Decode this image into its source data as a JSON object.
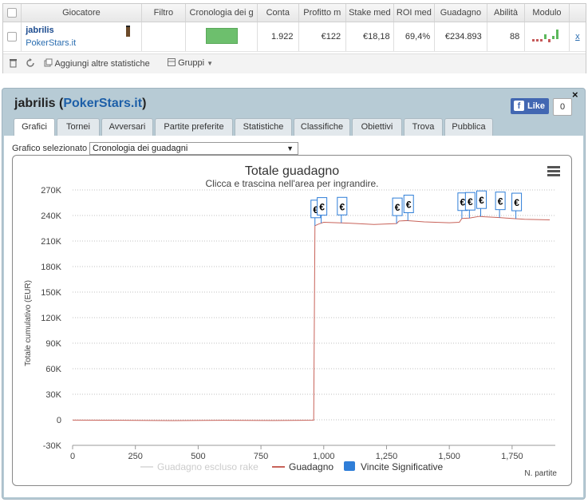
{
  "table": {
    "headers": [
      "Giocatore",
      "Filtro",
      "Cronologia dei g",
      "Conta",
      "Profitto m",
      "Stake med",
      "ROI med",
      "Guadagno",
      "Abilità",
      "Modulo"
    ],
    "row": {
      "player": "jabrilis",
      "site": "PokerStars.it",
      "count": "1.922",
      "avg_profit": "€122",
      "avg_stake": "€18,18",
      "avg_roi": "69,4%",
      "winnings": "€234.893",
      "ability": "88",
      "remove": "x"
    }
  },
  "toolbar": {
    "add_stats": "Aggiungi altre statistiche",
    "groups": "Gruppi"
  },
  "profile": {
    "name": "jabrilis",
    "site": "PokerStars.it",
    "like_label": "Like",
    "like_count": "0",
    "close": "×"
  },
  "tabs": [
    "Grafici",
    "Tornei",
    "Avversari",
    "Partite preferite",
    "Statistiche",
    "Classifiche",
    "Obiettivi",
    "Trova",
    "Pubblica"
  ],
  "active_tab": "Grafici",
  "chart_selector": {
    "label": "Grafico selezionato",
    "value": "Cronologia dei guadagni"
  },
  "chart_data": {
    "type": "line",
    "title": "Totale guadagno",
    "subtitle": "Clicca e trascina nell'area per ingrandire.",
    "ylabel": "Totale cumulativo (EUR)",
    "xlabel": "N. partite",
    "xlim": [
      0,
      1922
    ],
    "ylim": [
      -30000,
      270000
    ],
    "xticks": [
      0,
      250,
      500,
      750,
      1000,
      1250,
      1500,
      1750
    ],
    "xtick_labels": [
      "0",
      "250",
      "500",
      "750",
      "1,000",
      "1,250",
      "1,500",
      "1,750"
    ],
    "yticks": [
      -30000,
      0,
      30000,
      60000,
      90000,
      120000,
      150000,
      180000,
      210000,
      240000,
      270000
    ],
    "ytick_labels": [
      "-30K",
      "0",
      "30K",
      "60K",
      "90K",
      "120K",
      "150K",
      "180K",
      "210K",
      "240K",
      "270K"
    ],
    "grid": true,
    "legend_position": "bottom",
    "series": [
      {
        "name": "Guadagno escluso rake",
        "color": "#e0e0e0",
        "x": [],
        "y": []
      },
      {
        "name": "Guadagno",
        "color": "#c8635a",
        "x": [
          0,
          200,
          400,
          600,
          800,
          960,
          965,
          980,
          1000,
          1100,
          1200,
          1290,
          1300,
          1330,
          1400,
          1500,
          1540,
          1550,
          1580,
          1620,
          1640,
          1700,
          1750,
          1800,
          1900
        ],
        "y": [
          -300,
          -600,
          -900,
          -600,
          -800,
          -500,
          228000,
          230000,
          232000,
          231000,
          229500,
          230500,
          233500,
          234000,
          232500,
          231500,
          232000,
          236500,
          237000,
          239000,
          238500,
          237500,
          236500,
          235500,
          234800
        ]
      },
      {
        "name": "Vincite Significative",
        "type": "flags",
        "color": "#2f7ed8",
        "label": "€",
        "x": [
          965,
          990,
          1070,
          1290,
          1335,
          1550,
          1580,
          1625,
          1700,
          1765
        ]
      }
    ]
  }
}
